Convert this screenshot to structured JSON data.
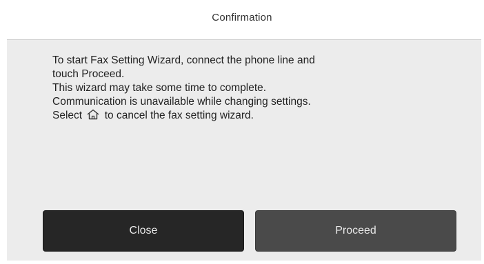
{
  "dialog": {
    "title": "Confirmation",
    "message": {
      "line1": "To start Fax Setting Wizard, connect the phone line and",
      "line2": "touch Proceed.",
      "line3": "This wizard may take some time to complete.",
      "line4": "Communication is unavailable while changing settings.",
      "line5_before_icon": "Select",
      "line5_icon": "home-icon",
      "line5_after_icon": "to cancel the fax setting wizard."
    },
    "buttons": {
      "close_label": "Close",
      "proceed_label": "Proceed"
    }
  },
  "colors": {
    "body_background": "#ececec",
    "close_button": "#262626",
    "proceed_button": "#4a4a4a",
    "button_text": "#e8e8e8"
  }
}
